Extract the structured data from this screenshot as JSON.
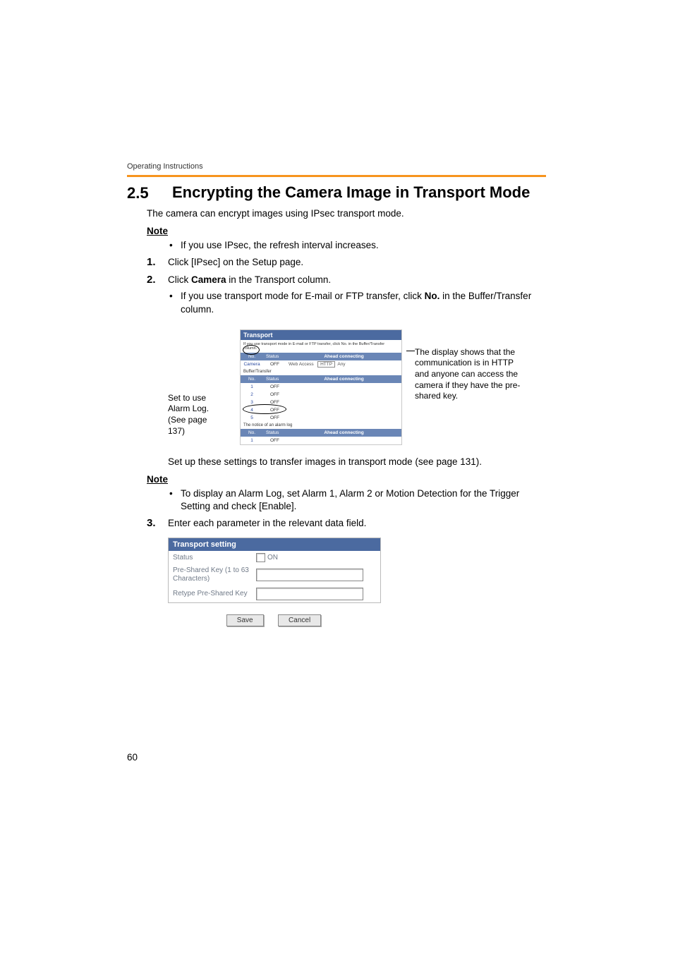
{
  "header": {
    "running_head": "Operating Instructions"
  },
  "section": {
    "number": "2.5",
    "title": "Encrypting the Camera Image in Transport Mode"
  },
  "intro": "The camera can encrypt images using IPsec transport mode.",
  "note1_label": "Note",
  "note1_bullet": "If you use IPsec, the refresh interval increases.",
  "steps": {
    "s1_num": "1.",
    "s1_text": "Click [IPsec] on the Setup page.",
    "s2_num": "2.",
    "s2_text_pre": "Click ",
    "s2_text_bold": "Camera",
    "s2_text_post": " in the Transport column.",
    "s2_bullet_pre": "If you use transport mode for E-mail or FTP transfer, click ",
    "s2_bullet_bold": "No.",
    "s2_bullet_post": " in the Buffer/Transfer column.",
    "s3_num": "3.",
    "s3_text": "Enter each parameter in the relevant data field."
  },
  "figure": {
    "left_callout": "Set to use Alarm Log. (See page 137)",
    "right_callout": "The display shows that the communication is in HTTP and anyone can access the camera if they have the pre-shared key.",
    "panel_title": "Transport",
    "panel_note": "If you use transport mode in E-mail or FTP transfer, click No. in the Buffer/Transfer column.",
    "header_no": "No.",
    "header_status": "Status",
    "header_ahead": "Ahead connecting",
    "row1_no": "Camera",
    "row1_status": "OFF",
    "row1_web": "Web Access",
    "row1_http": "HTTP",
    "row1_any": "Any",
    "buffer_label": "Buffer/Transfer",
    "buffer_rows": [
      {
        "no": "1",
        "status": "OFF"
      },
      {
        "no": "2",
        "status": "OFF"
      },
      {
        "no": "3",
        "status": "OFF"
      },
      {
        "no": "4",
        "status": "OFF"
      },
      {
        "no": "5",
        "status": "OFF"
      }
    ],
    "alarm_label": "The notice of an alarm log",
    "alarm_rows": [
      {
        "no": "1",
        "status": "OFF"
      }
    ]
  },
  "setup_line": "Set up these settings to transfer images in transport mode (see page 131).",
  "note2_label": "Note",
  "note2_bullet": "To display an Alarm Log, set Alarm 1, Alarm 2 or Motion Detection for the Trigger Setting and check [Enable].",
  "settings": {
    "title": "Transport setting",
    "status_label": "Status",
    "status_on": "ON",
    "psk_label": "Pre-Shared Key (1 to 63 Characters)",
    "retype_label": "Retype Pre-Shared Key",
    "save": "Save",
    "cancel": "Cancel"
  },
  "page_number": "60"
}
